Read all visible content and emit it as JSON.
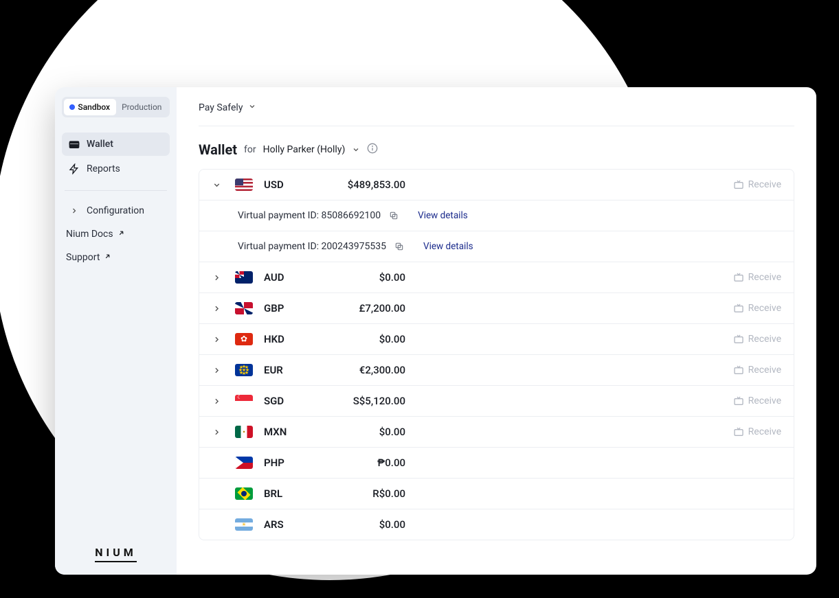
{
  "sidebar": {
    "env": {
      "sandbox": "Sandbox",
      "production": "Production"
    },
    "wallet": "Wallet",
    "reports": "Reports",
    "configuration": "Configuration",
    "docs": "Nium Docs",
    "support": "Support",
    "brand": "NIUM"
  },
  "topbar": {
    "product": "Pay Safely"
  },
  "header": {
    "title": "Wallet",
    "for": "for",
    "who": "Holly Parker (Holly)"
  },
  "labels": {
    "receive": "Receive",
    "vpa": "Virtual payment ID:",
    "viewDetails": "View details"
  },
  "currencies": [
    {
      "code": "USD",
      "amount": "$489,853.00",
      "flag": "us",
      "expanded": true,
      "hasReceive": true,
      "vpas": [
        {
          "id": "85086692100"
        },
        {
          "id": "200243975535"
        }
      ]
    },
    {
      "code": "AUD",
      "amount": "$0.00",
      "flag": "au",
      "hasReceive": true,
      "hasChevron": true
    },
    {
      "code": "GBP",
      "amount": "£7,200.00",
      "flag": "gb",
      "hasReceive": true,
      "hasChevron": true
    },
    {
      "code": "HKD",
      "amount": "$0.00",
      "flag": "hk",
      "hasReceive": true,
      "hasChevron": true
    },
    {
      "code": "EUR",
      "amount": "€2,300.00",
      "flag": "eu",
      "hasReceive": true,
      "hasChevron": true
    },
    {
      "code": "SGD",
      "amount": "S$5,120.00",
      "flag": "sg",
      "hasReceive": true,
      "hasChevron": true
    },
    {
      "code": "MXN",
      "amount": "$0.00",
      "flag": "mx",
      "hasReceive": true,
      "hasChevron": true
    },
    {
      "code": "PHP",
      "amount": "₱0.00",
      "flag": "ph",
      "hasReceive": false,
      "hasChevron": false
    },
    {
      "code": "BRL",
      "amount": "R$0.00",
      "flag": "br",
      "hasReceive": false,
      "hasChevron": false
    },
    {
      "code": "ARS",
      "amount": "$0.00",
      "flag": "ar",
      "hasReceive": false,
      "hasChevron": false
    }
  ]
}
